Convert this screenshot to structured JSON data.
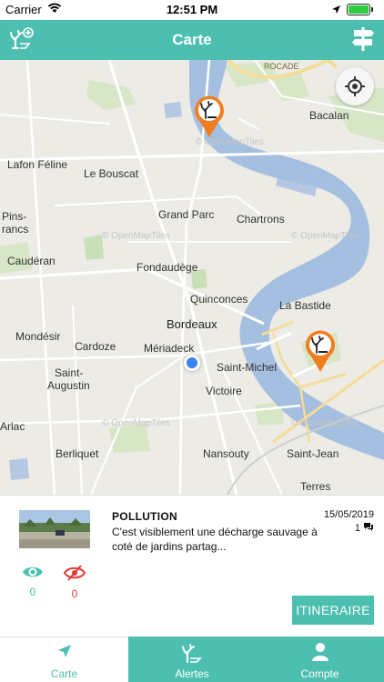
{
  "status": {
    "carrier": "Carrier",
    "time": "12:51 PM"
  },
  "header": {
    "title": "Carte"
  },
  "map": {
    "labels": {
      "bacalan": "Bacalan",
      "lafon": "Lafon Féline",
      "bouscat": "Le Bouscat",
      "grandparc": "Grand Parc",
      "chartrons": "Chartrons",
      "pins": "Pins-",
      "rancs": "rancs",
      "cauderan": "Caudéran",
      "fondaudege": "Fondaudège",
      "quinconces": "Quinconces",
      "bastide": "La Bastide",
      "bordeaux": "Bordeaux",
      "mondesir": "Mondésir",
      "cardoze": "Cardoze",
      "meriadeck": "Mériadeck",
      "saintaugustin1": "Saint-",
      "saintaugustin2": "Augustin",
      "saintmichel": "Saint-Michel",
      "victoire": "Victoire",
      "arlac": "Arlac",
      "berliquet": "Berliquet",
      "nansouty": "Nansouty",
      "saintjean": "Saint-Jean",
      "terres": "Terres",
      "rocade": "ROCADE"
    },
    "watermark": "© OpenMapTiles"
  },
  "alert": {
    "category": "POLLUTION",
    "description": "C'est visiblement une décharge sauvage à coté de jardins partag...",
    "date": "15/05/2019",
    "comment_count": "1",
    "seen_count": "0",
    "unseen_count": "0",
    "route_button": "ITINERAIRE"
  },
  "tabs": [
    {
      "label": "Carte"
    },
    {
      "label": "Alertes"
    },
    {
      "label": "Compte"
    }
  ],
  "colors": {
    "accent": "#4cbfb0",
    "pin": "#f07d1e",
    "unseen": "#e53935"
  }
}
